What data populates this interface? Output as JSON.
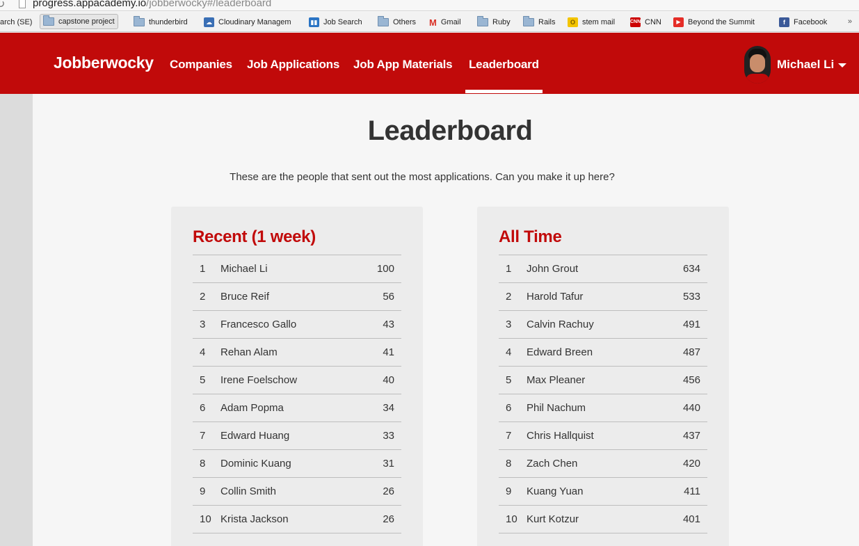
{
  "browser": {
    "url_host": "progress.appacademy.io",
    "url_path": "/jobberwocky#/leaderboard",
    "bookmarks": [
      {
        "label": "arch (SE)",
        "icon": "none"
      },
      {
        "label": "capstone project",
        "icon": "folder-icon"
      },
      {
        "label": "thunderbird",
        "icon": "folder-icon"
      },
      {
        "label": "Cloudinary Managem",
        "icon": "cloudinary-icon"
      },
      {
        "label": "Job Search",
        "icon": "trello-icon"
      },
      {
        "label": "Others",
        "icon": "folder-icon"
      },
      {
        "label": "Gmail",
        "icon": "gmail-icon"
      },
      {
        "label": "Ruby",
        "icon": "folder-icon"
      },
      {
        "label": "Rails",
        "icon": "folder-icon"
      },
      {
        "label": "stem mail",
        "icon": "mail-icon"
      },
      {
        "label": "CNN",
        "icon": "cnn-icon"
      },
      {
        "label": "Beyond the Summit",
        "icon": "youtube-icon"
      },
      {
        "label": "Facebook",
        "icon": "facebook-icon"
      }
    ],
    "more_label": "»"
  },
  "nav": {
    "brand": "Jobberwocky",
    "links": [
      "Companies",
      "Job Applications",
      "Job App Materials",
      "Leaderboard"
    ],
    "active": "Leaderboard",
    "user_name": "Michael Li",
    "accent_color": "#c10a0a"
  },
  "page": {
    "title": "Leaderboard",
    "subtitle": "These are the people that sent out the most applications. Can you make it up here?"
  },
  "leaderboards": {
    "recent": {
      "title": "Recent (1 week)",
      "rows": [
        {
          "rank": "1",
          "name": "Michael Li",
          "count": "100"
        },
        {
          "rank": "2",
          "name": "Bruce Reif",
          "count": "56"
        },
        {
          "rank": "3",
          "name": "Francesco Gallo",
          "count": "43"
        },
        {
          "rank": "4",
          "name": "Rehan Alam",
          "count": "41"
        },
        {
          "rank": "5",
          "name": "Irene Foelschow",
          "count": "40"
        },
        {
          "rank": "6",
          "name": "Adam Popma",
          "count": "34"
        },
        {
          "rank": "7",
          "name": "Edward Huang",
          "count": "33"
        },
        {
          "rank": "8",
          "name": "Dominic Kuang",
          "count": "31"
        },
        {
          "rank": "9",
          "name": "Collin Smith",
          "count": "26"
        },
        {
          "rank": "10",
          "name": "Krista Jackson",
          "count": "26"
        }
      ]
    },
    "all_time": {
      "title": "All Time",
      "rows": [
        {
          "rank": "1",
          "name": "John Grout",
          "count": "634"
        },
        {
          "rank": "2",
          "name": "Harold Tafur",
          "count": "533"
        },
        {
          "rank": "3",
          "name": "Calvin Rachuy",
          "count": "491"
        },
        {
          "rank": "4",
          "name": "Edward Breen",
          "count": "487"
        },
        {
          "rank": "5",
          "name": "Max Pleaner",
          "count": "456"
        },
        {
          "rank": "6",
          "name": "Phil Nachum",
          "count": "440"
        },
        {
          "rank": "7",
          "name": "Chris Hallquist",
          "count": "437"
        },
        {
          "rank": "8",
          "name": "Zach Chen",
          "count": "420"
        },
        {
          "rank": "9",
          "name": "Kuang Yuan",
          "count": "411"
        },
        {
          "rank": "10",
          "name": "Kurt Kotzur",
          "count": "401"
        }
      ]
    }
  }
}
